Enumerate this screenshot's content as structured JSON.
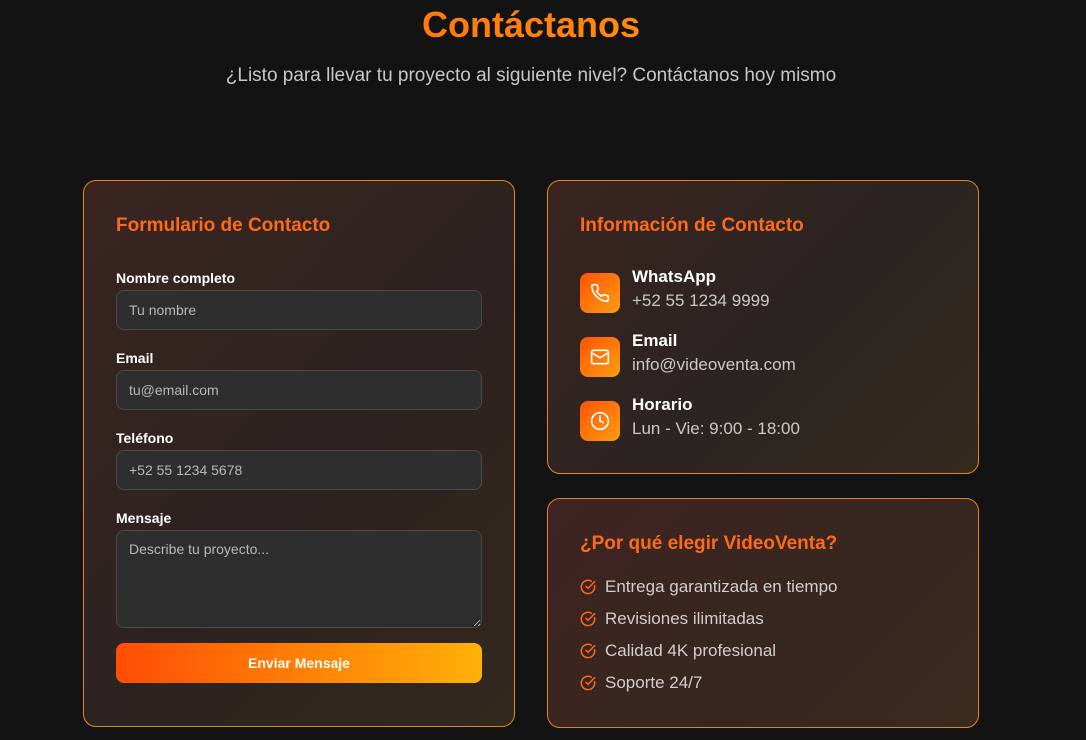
{
  "header": {
    "title": "Contáctanos",
    "subtitle": "¿Listo para llevar tu proyecto al siguiente nivel? Contáctanos hoy mismo"
  },
  "form": {
    "title": "Formulario de Contacto",
    "name_label": "Nombre completo",
    "name_placeholder": "Tu nombre",
    "email_label": "Email",
    "email_placeholder": "tu@email.com",
    "phone_label": "Teléfono",
    "phone_placeholder": "+52 55 1234 5678",
    "message_label": "Mensaje",
    "message_placeholder": "Describe tu proyecto...",
    "submit_label": "Enviar Mensaje"
  },
  "contact_info": {
    "title": "Información de Contacto",
    "items": [
      {
        "icon": "phone-icon",
        "name": "WhatsApp",
        "value": "+52 55 1234 9999"
      },
      {
        "icon": "mail-icon",
        "name": "Email",
        "value": "info@videoventa.com"
      },
      {
        "icon": "clock-icon",
        "name": "Horario",
        "value": "Lun - Vie: 9:00 - 18:00"
      }
    ]
  },
  "why": {
    "title": "¿Por qué elegir VideoVenta?",
    "items": [
      "Entrega garantizada en tiempo",
      "Revisiones ilimitadas",
      "Calidad 4K profesional",
      "Soporte 24/7"
    ]
  },
  "colors": {
    "accent": "#ff6a1a",
    "gradient_start": "#ff4d05",
    "gradient_end": "#ffb108",
    "background": "#131313"
  }
}
